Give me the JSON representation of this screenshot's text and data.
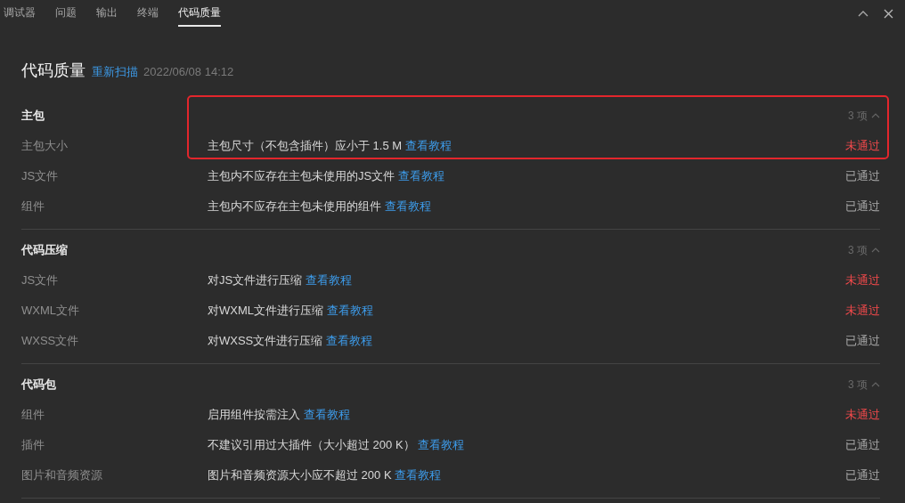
{
  "tabs": [
    {
      "label": "调试器",
      "selected": false
    },
    {
      "label": "问题",
      "selected": false
    },
    {
      "label": "输出",
      "selected": false
    },
    {
      "label": "终端",
      "selected": false
    },
    {
      "label": "代码质量",
      "selected": true
    }
  ],
  "header": {
    "title": "代码质量",
    "rescan": "重新扫描",
    "time": "2022/06/08 14:12"
  },
  "sections": [
    {
      "title": "主包",
      "count": "3 项",
      "expanded": true,
      "items": [
        {
          "name": "主包大小",
          "rule": "主包尺寸（不包含插件）应小于 1.5 M",
          "link": "查看教程",
          "status": "未通过",
          "passed": false,
          "highlighted": true
        },
        {
          "name": "JS文件",
          "rule": "主包内不应存在主包未使用的JS文件",
          "link": "查看教程",
          "status": "已通过",
          "passed": true,
          "highlighted": false
        },
        {
          "name": "组件",
          "rule": "主包内不应存在主包未使用的组件",
          "link": "查看教程",
          "status": "已通过",
          "passed": true,
          "highlighted": false
        }
      ]
    },
    {
      "title": "代码压缩",
      "count": "3 项",
      "expanded": true,
      "items": [
        {
          "name": "JS文件",
          "rule": "对JS文件进行压缩",
          "link": "查看教程",
          "status": "未通过",
          "passed": false,
          "highlighted": false
        },
        {
          "name": "WXML文件",
          "rule": "对WXML文件进行压缩",
          "link": "查看教程",
          "status": "未通过",
          "passed": false,
          "highlighted": false
        },
        {
          "name": "WXSS文件",
          "rule": "对WXSS文件进行压缩",
          "link": "查看教程",
          "status": "已通过",
          "passed": true,
          "highlighted": false
        }
      ]
    },
    {
      "title": "代码包",
      "count": "3 项",
      "expanded": true,
      "items": [
        {
          "name": "组件",
          "rule": "启用组件按需注入",
          "link": "查看教程",
          "status": "未通过",
          "passed": false,
          "highlighted": false
        },
        {
          "name": "插件",
          "rule": "不建议引用过大插件（大小超过 200 K）",
          "link": "查看教程",
          "status": "已通过",
          "passed": true,
          "highlighted": false
        },
        {
          "name": "图片和音频资源",
          "rule": "图片和音频资源大小应不超过 200 K",
          "link": "查看教程",
          "status": "已通过",
          "passed": true,
          "highlighted": false
        }
      ]
    }
  ]
}
